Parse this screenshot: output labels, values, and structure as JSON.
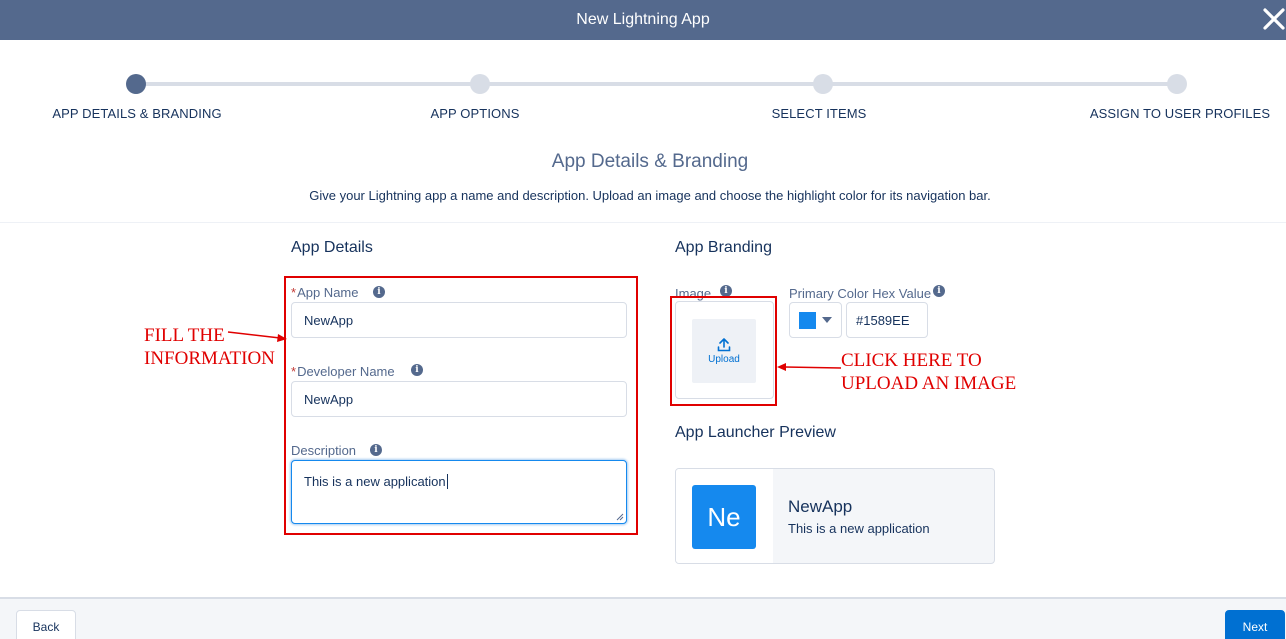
{
  "header": {
    "title": "New Lightning App"
  },
  "progress": {
    "steps": [
      {
        "label": "APP DETAILS & BRANDING",
        "active": true
      },
      {
        "label": "APP OPTIONS",
        "active": false
      },
      {
        "label": "SELECT ITEMS",
        "active": false
      },
      {
        "label": "ASSIGN TO USER PROFILES",
        "active": false
      }
    ]
  },
  "section": {
    "title": "App Details & Branding",
    "description": "Give your Lightning app a name and description. Upload an image and choose the highlight color for its navigation bar."
  },
  "app_details": {
    "title": "App Details",
    "app_name": {
      "required_mark": "*",
      "label": "App Name",
      "value": "NewApp"
    },
    "developer_name": {
      "required_mark": "*",
      "label": "Developer Name",
      "value": "NewApp"
    },
    "description": {
      "label": "Description",
      "value": "This is a new application"
    }
  },
  "app_branding": {
    "title": "App Branding",
    "image_label": "Image",
    "upload_label": "Upload",
    "color_label": "Primary Color Hex Value",
    "color_value": "#1589EE",
    "swatch_color": "#1589EE"
  },
  "preview": {
    "title": "App Launcher Preview",
    "tile_text": "Ne",
    "app_name": "NewApp",
    "app_description": "This is a new application"
  },
  "annotations": {
    "fill_line1": "FILL THE",
    "fill_line2": "INFORMATION",
    "upload_line1": "CLICK HERE TO",
    "upload_line2": "UPLOAD AN IMAGE"
  },
  "footer": {
    "back_label": "Back",
    "next_label": "Next"
  },
  "icons": {
    "close": "close-icon",
    "info": "info-icon",
    "upload": "upload-icon",
    "dropdown": "chevron-down-icon"
  }
}
